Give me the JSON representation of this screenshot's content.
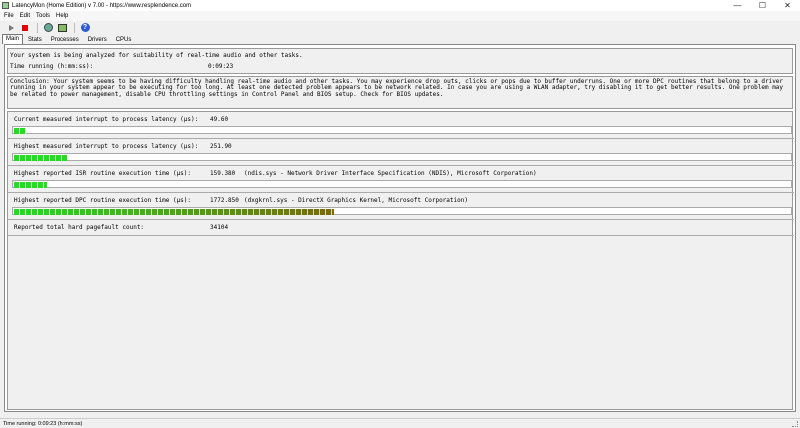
{
  "window": {
    "title": "LatencyMon  (Home Edition)  v 7.00 - https://www.resplendence.com",
    "controls": {
      "minimize": "—",
      "maximize": "☐",
      "close": "✕"
    }
  },
  "menu": [
    "File",
    "Edit",
    "Tools",
    "Help"
  ],
  "toolbar": {
    "icons": [
      "play-icon",
      "stop-icon",
      "gear-icon",
      "drivers-icon",
      "help-icon"
    ]
  },
  "tabs": [
    {
      "label": "Main",
      "active": true
    },
    {
      "label": "Stats",
      "active": false
    },
    {
      "label": "Processes",
      "active": false
    },
    {
      "label": "Drivers",
      "active": false
    },
    {
      "label": "CPUs",
      "active": false
    }
  ],
  "main": {
    "status_line": "Your system is being analyzed for suitability of real-time audio and other tasks.",
    "time_running_label": "Time running (h:mm:ss):",
    "time_running_value": "0:09:23",
    "conclusion": "Conclusion: Your system seems to be having difficulty handling real-time audio and other tasks. You may experience drop outs, clicks or pops due to buffer underruns. One or more DPC routines that belong to a driver running in your system appear to be executing for too long. At least one detected problem appears to be network related. In case you are using a WLAN adapter, try disabling it to get better results. One problem may be related to power management, disable CPU throttling settings in Control Panel and BIOS setup. Check for BIOS updates.",
    "metrics": [
      {
        "label": "Current measured interrupt to process latency (µs):",
        "value": "49.60",
        "detail": "",
        "level": 0.016,
        "color": "#22dd22"
      },
      {
        "label": "Highest measured interrupt to process latency (µs):",
        "value": "251.90",
        "detail": "",
        "level": 0.068,
        "color": "#22dd22"
      },
      {
        "label": "Highest reported ISR routine execution time (µs):",
        "value": "159.380",
        "detail": "(ndis.sys - Network Driver Interface Specification (NDIS), Microsoft Corporation)",
        "level": 0.043,
        "color": "#22dd22"
      },
      {
        "label": "Highest reported DPC routine execution time (µs):",
        "value": "1772.850",
        "detail": "(dxgkrnl.sys - DirectX Graphics Kernel, Microsoft Corporation)",
        "level": 0.412,
        "color": "#22dd22",
        "color_end": "#7a6a08"
      },
      {
        "label": "Reported total hard pagefault count:",
        "value": "34104",
        "detail": "",
        "level": null
      }
    ]
  },
  "statusbar": {
    "text": "Time running: 0:09:23  (h:mm:ss)"
  }
}
